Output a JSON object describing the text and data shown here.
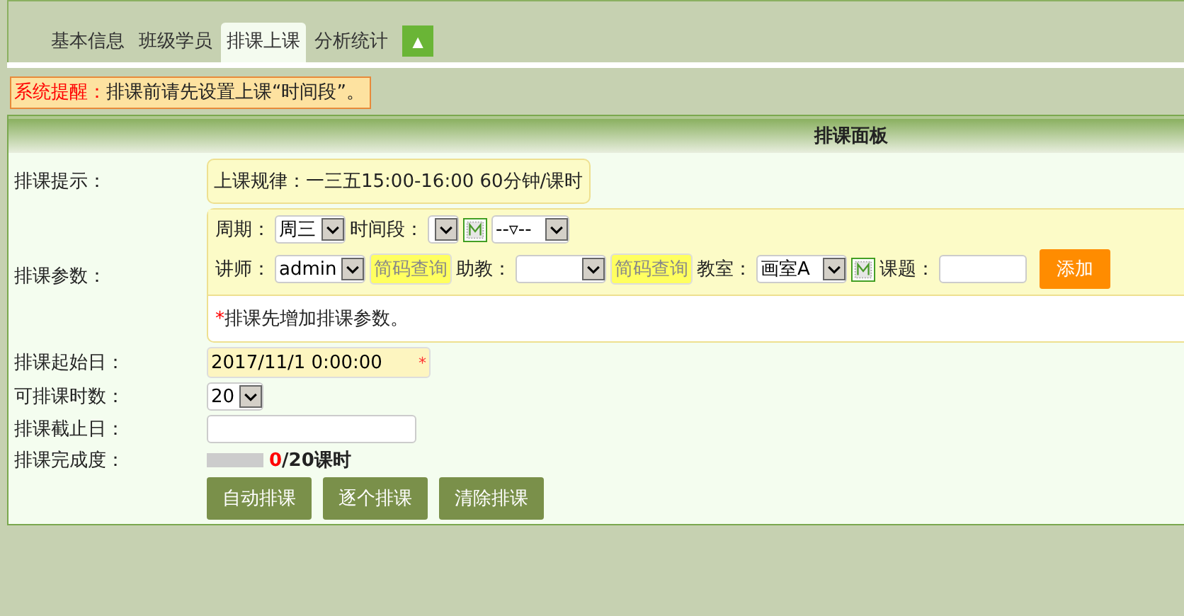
{
  "tabs": [
    {
      "label": "基本信息",
      "selected": false
    },
    {
      "label": "班级学员",
      "selected": false
    },
    {
      "label": "排课上课",
      "selected": true
    },
    {
      "label": "分析统计",
      "selected": false
    }
  ],
  "collapse_button": "▲",
  "alert": {
    "label": "系统提醒：",
    "message": "排课前请先设置上课“时间段”。"
  },
  "panel": {
    "title": "排课面板",
    "hint": {
      "label": "排课提示：",
      "text": "上课规律：一三五15:00-16:00 60分钟/课时"
    },
    "params": {
      "label": "排课参数：",
      "cycle": {
        "label": "周期：",
        "value": "周三"
      },
      "time_slot": {
        "label": "时间段："
      },
      "time_slot_2": {
        "value": "--▿--"
      },
      "teacher": {
        "label": "讲师：",
        "value": "admin"
      },
      "lookup_1": "简码查询",
      "assistant": {
        "label": "助教："
      },
      "lookup_2": "简码查询",
      "room": {
        "label": "教室：",
        "value": "画室A"
      },
      "topic": {
        "label": "课题："
      },
      "add_button": "添加",
      "note_mark": "*",
      "note": "排课先增加排课参数。"
    },
    "start_date": {
      "label": "排课起始日：",
      "value": "2017/11/1 0:00:00",
      "required": true
    },
    "hours": {
      "label": "可排课时数：",
      "value": "20"
    },
    "end_date": {
      "label": "排课截止日："
    },
    "progress": {
      "label": "排课完成度：",
      "level": 0,
      "done": "0",
      "total": "/20课时"
    },
    "buttons": [
      "自动排课",
      "逐个排课",
      "清除排课"
    ]
  }
}
